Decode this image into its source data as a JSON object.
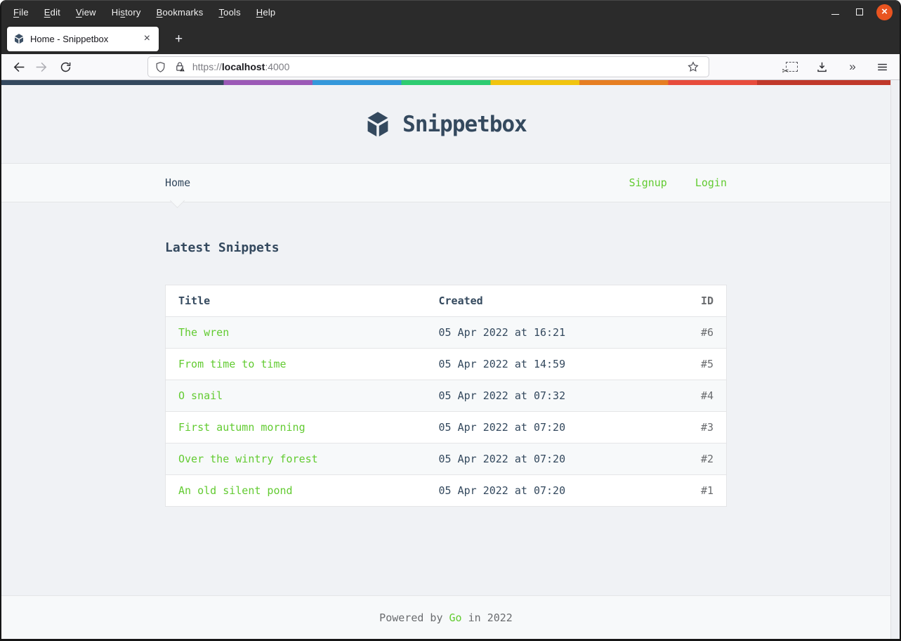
{
  "colors": {
    "accent_green": "#62CB31",
    "text_primary": "#34495E",
    "text_muted": "#6A6C6F",
    "page_bg": "#F0F2F5",
    "panel_bg": "#F7F9FA",
    "border": "#E4E5E7",
    "close_button": "#E95420",
    "logo": "#34495E",
    "rainbow": [
      {
        "color": "#34495E",
        "from": 0,
        "to": 25
      },
      {
        "color": "#9B59B6",
        "from": 25,
        "to": 35
      },
      {
        "color": "#3498DB",
        "from": 35,
        "to": 45
      },
      {
        "color": "#2ECC71",
        "from": 45,
        "to": 55
      },
      {
        "color": "#F1C40F",
        "from": 55,
        "to": 65
      },
      {
        "color": "#E67E22",
        "from": 65,
        "to": 75
      },
      {
        "color": "#E74C3C",
        "from": 75,
        "to": 85
      },
      {
        "color": "#C0392B",
        "from": 85,
        "to": 100
      }
    ]
  },
  "browser": {
    "menu_items": [
      {
        "label": "File",
        "mnemonic": 0
      },
      {
        "label": "Edit",
        "mnemonic": 0
      },
      {
        "label": "View",
        "mnemonic": 0
      },
      {
        "label": "History",
        "mnemonic": 2
      },
      {
        "label": "Bookmarks",
        "mnemonic": 0
      },
      {
        "label": "Tools",
        "mnemonic": 0
      },
      {
        "label": "Help",
        "mnemonic": 0
      }
    ],
    "tab_title": "Home - Snippetbox",
    "new_tab_glyph": "+",
    "close_glyph": "×",
    "url": {
      "scheme": "https://",
      "host": "localhost",
      "port": ":4000"
    },
    "overflow_glyph": "»"
  },
  "page": {
    "site_title": "Snippetbox",
    "nav": {
      "home": "Home",
      "signup": "Signup",
      "login": "Login"
    },
    "heading": "Latest Snippets",
    "table": {
      "headers": [
        "Title",
        "Created",
        "ID"
      ],
      "rows": [
        {
          "title": "The wren",
          "created": "05 Apr 2022 at 16:21",
          "id": "#6"
        },
        {
          "title": "From time to time",
          "created": "05 Apr 2022 at 14:59",
          "id": "#5"
        },
        {
          "title": "O snail",
          "created": "05 Apr 2022 at 07:32",
          "id": "#4"
        },
        {
          "title": "First autumn morning",
          "created": "05 Apr 2022 at 07:20",
          "id": "#3"
        },
        {
          "title": "Over the wintry forest",
          "created": "05 Apr 2022 at 07:20",
          "id": "#2"
        },
        {
          "title": "An old silent pond",
          "created": "05 Apr 2022 at 07:20",
          "id": "#1"
        }
      ]
    },
    "footer": {
      "prefix": "Powered by ",
      "link": "Go",
      "suffix": " in 2022"
    }
  }
}
